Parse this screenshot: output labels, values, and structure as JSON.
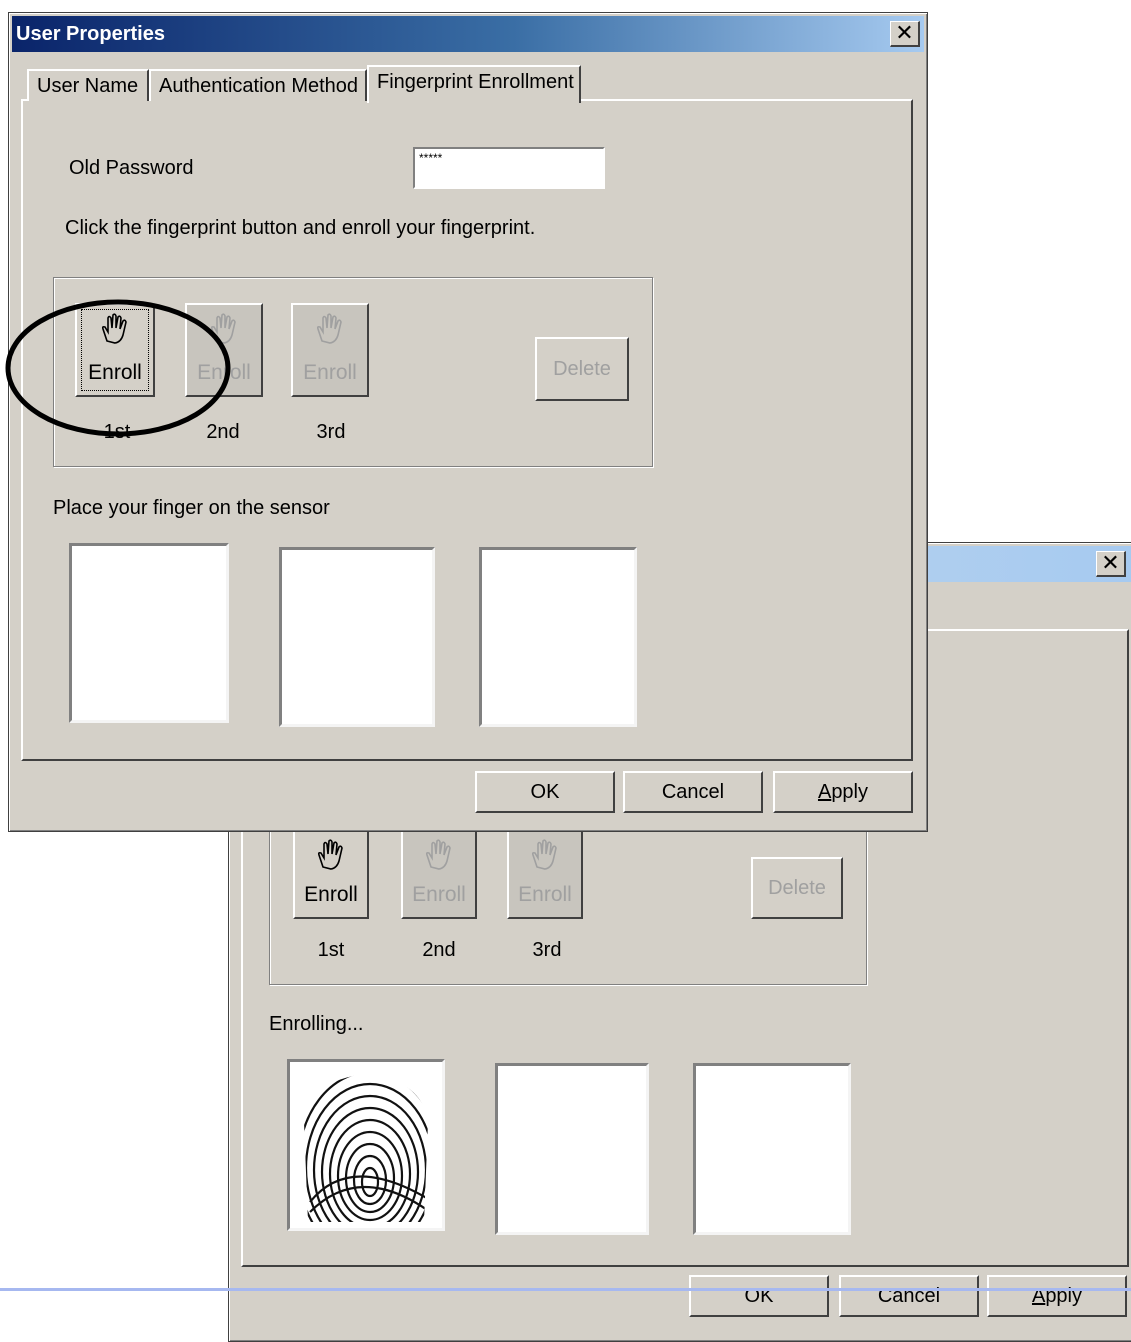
{
  "back_dialog": {
    "enroll_buttons": [
      {
        "label": "Enroll",
        "ordinal": "1st"
      },
      {
        "label": "Enroll",
        "ordinal": "2nd"
      },
      {
        "label": "Enroll",
        "ordinal": "3rd"
      }
    ],
    "delete_label": "Delete",
    "status_text": "Enrolling...",
    "buttons": {
      "ok": "OK",
      "cancel": "Cancel",
      "apply_prefix": "A",
      "apply_rest": "pply"
    }
  },
  "front_dialog": {
    "title": "User Properties",
    "tabs": [
      "User Name",
      "Authentication Method",
      "Fingerprint Enrollment"
    ],
    "active_tab": "Fingerprint Enrollment",
    "old_password_label": "Old Password",
    "old_password_value": "*****",
    "instruction": "Click the fingerprint button and enroll your fingerprint.",
    "enroll_buttons": [
      {
        "label": "Enroll",
        "ordinal": "1st"
      },
      {
        "label": "Enroll",
        "ordinal": "2nd"
      },
      {
        "label": "Enroll",
        "ordinal": "3rd"
      }
    ],
    "delete_label": "Delete",
    "status_text": "Place your finger on the sensor",
    "buttons": {
      "ok": "OK",
      "cancel": "Cancel",
      "apply_prefix": "A",
      "apply_rest": "pply"
    }
  },
  "icons": {
    "enroll": "hand-icon",
    "close": "close-icon",
    "fingerprint": "fingerprint-image"
  },
  "colors": {
    "title_active": "#0a246a",
    "title_gradient_end": "#a6caf0",
    "face": "#d4d0c8",
    "annotation": "#000000"
  }
}
